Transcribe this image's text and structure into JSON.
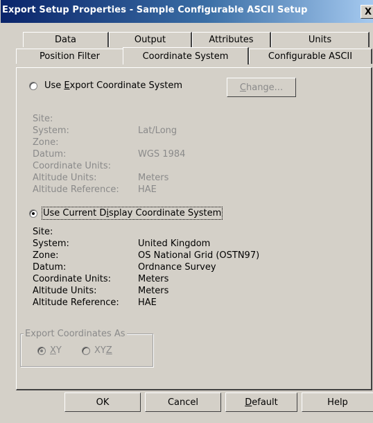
{
  "window": {
    "title": "Export Setup Properties - Sample Configurable ASCII Setup",
    "close_glyph": "X"
  },
  "tabs": {
    "row1": [
      "Data",
      "Output",
      "Attributes",
      "Units"
    ],
    "row2": [
      "Position Filter",
      "Coordinate System",
      "Configurable ASCII"
    ],
    "active": "Coordinate System"
  },
  "export_system": {
    "radio_label": "Use Export Coordinate System",
    "selected": false,
    "change_button": "Change...",
    "fields": [
      {
        "label": "Site:",
        "value": ""
      },
      {
        "label": "System:",
        "value": "Lat/Long"
      },
      {
        "label": "Zone:",
        "value": ""
      },
      {
        "label": "Datum:",
        "value": "WGS 1984"
      },
      {
        "label": "Coordinate Units:",
        "value": ""
      },
      {
        "label": "Altitude Units:",
        "value": "Meters"
      },
      {
        "label": "Altitude Reference:",
        "value": "HAE"
      }
    ]
  },
  "display_system": {
    "radio_label": "Use Current Display Coordinate System",
    "selected": true,
    "fields": [
      {
        "label": "Site:",
        "value": ""
      },
      {
        "label": "System:",
        "value": "United Kingdom"
      },
      {
        "label": "Zone:",
        "value": "OS National Grid (OSTN97)"
      },
      {
        "label": "Datum:",
        "value": "Ordnance Survey"
      },
      {
        "label": "Coordinate Units:",
        "value": "Meters"
      },
      {
        "label": "Altitude Units:",
        "value": "Meters"
      },
      {
        "label": "Altitude Reference:",
        "value": "HAE"
      }
    ]
  },
  "export_as": {
    "group_label": "Export Coordinates As",
    "options": [
      "XY",
      "XYZ"
    ],
    "selected": "XY"
  },
  "footer": {
    "ok": "OK",
    "cancel": "Cancel",
    "default": "Default",
    "help": "Help"
  }
}
